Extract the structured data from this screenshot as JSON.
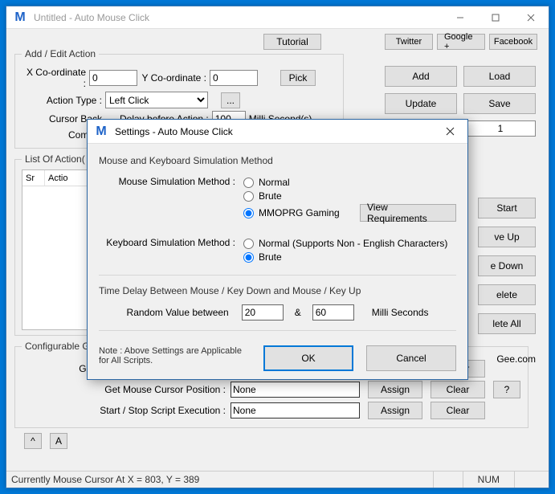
{
  "main": {
    "logo_letter": "M",
    "title": "Untitled - Auto Mouse Click",
    "tutorial": "Tutorial",
    "links": {
      "twitter": "Twitter",
      "google": "Google +",
      "facebook": "Facebook"
    }
  },
  "add_edit": {
    "legend": "Add / Edit Action",
    "x_label": "X Co-ordinate :",
    "x_value": "0",
    "y_label": "Y Co-ordinate :",
    "y_value": "0",
    "pick": "Pick",
    "action_type_label": "Action Type :",
    "action_type_value": "Left Click",
    "ellipsis": "...",
    "cursor_back": "Cursor Back",
    "delay_label": "Delay before Action :",
    "delay_value": "100",
    "delay_unit": "Milli Second(s)",
    "comment": "Comme"
  },
  "right": {
    "add": "Add",
    "load": "Load",
    "update": "Update",
    "save": "Save",
    "repeat_value": "1",
    "start": "Start",
    "move_up": "ve Up",
    "move_down": "e Down",
    "delete": "elete",
    "delete_all": "lete All",
    "gee": "Gee.com"
  },
  "list": {
    "legend": "List Of Action(",
    "col_sr": "Sr",
    "col_action": "Actio"
  },
  "config": {
    "legend": "Configurable G",
    "row1": "Get Mouse Position & Add Action :",
    "row2": "Get Mouse Cursor Position :",
    "row3": "Start / Stop Script Execution :",
    "none": "None",
    "assign": "Assign",
    "clear": "Clear",
    "help": "?"
  },
  "bottom": {
    "caret": "^",
    "a": "A"
  },
  "status": {
    "text": "Currently Mouse Cursor At X = 803, Y = 389",
    "num": "NUM"
  },
  "modal": {
    "title": "Settings - Auto Mouse Click",
    "section1": "Mouse and Keyboard Simulation Method",
    "mouse_label": "Mouse Simulation Method :",
    "mouse_options": {
      "normal": "Normal",
      "brute": "Brute",
      "mmorpg": "MMOPRG Gaming"
    },
    "view_req": "View Requirements",
    "kb_label": "Keyboard Simulation Method :",
    "kb_options": {
      "normal": "Normal (Supports Non - English Characters)",
      "brute": "Brute"
    },
    "section2": "Time Delay Between Mouse / Key Down and Mouse / Key Up",
    "rand_label": "Random Value between",
    "rand_min": "20",
    "and": "&",
    "rand_max": "60",
    "ms": "Milli Seconds",
    "note": "Note : Above Settings are Applicable for All Scripts.",
    "ok": "OK",
    "cancel": "Cancel"
  }
}
